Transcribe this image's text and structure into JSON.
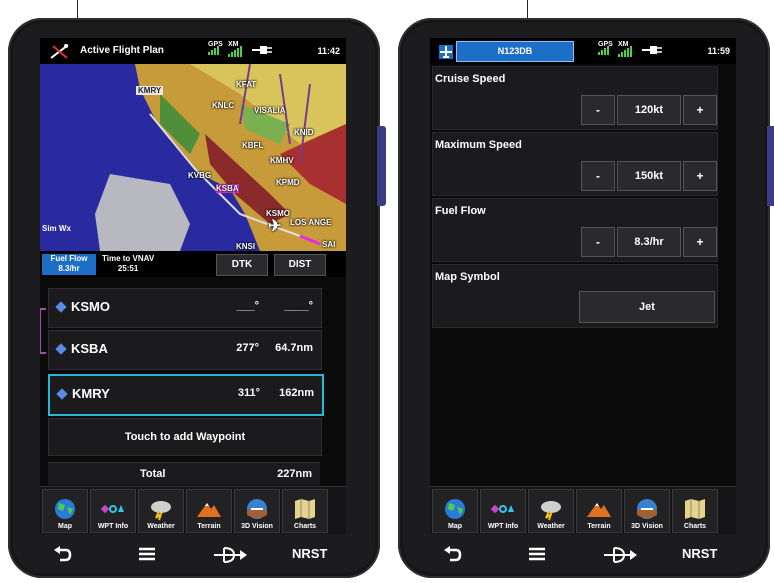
{
  "left_screen": {
    "title": "Active Flight Plan",
    "status": {
      "gps": "GPS",
      "xm": "XM",
      "time": "11:42"
    },
    "map": {
      "labels": [
        "KFAT",
        "KMRY",
        "KNLC",
        "VISALIA",
        "KNID",
        "KBFL",
        "KMHV",
        "KVBG",
        "KSBA",
        "KPMD",
        "KSMO",
        "LOS ANGE",
        "KNSI",
        "SAI"
      ],
      "sim_wx": "Sim Wx"
    },
    "info": {
      "fuel_flow_label": "Fuel Flow",
      "fuel_flow_value": "8.3/hr",
      "vnav_label": "Time to VNAV",
      "vnav_value": "25:51",
      "col1": "DTK",
      "col2": "DIST"
    },
    "waypoints": [
      {
        "name": "KSMO",
        "dtk": "___°",
        "dist": "____°"
      },
      {
        "name": "KSBA",
        "dtk": "277°",
        "dist": "64.7nm"
      },
      {
        "name": "KMRY",
        "dtk": "311°",
        "dist": "162nm"
      }
    ],
    "add_waypoint": "Touch to add Waypoint",
    "total_label": "Total",
    "total_value": "227nm"
  },
  "right_screen": {
    "tail_number": "N123DB",
    "status": {
      "gps": "GPS",
      "xm": "XM",
      "time": "11:59"
    },
    "cruise": {
      "title": "Cruise Speed",
      "minus": "-",
      "value": "120kt",
      "plus": "+"
    },
    "max": {
      "title": "Maximum Speed",
      "minus": "-",
      "value": "150kt",
      "plus": "+"
    },
    "fuel": {
      "title": "Fuel Flow",
      "minus": "-",
      "value": "8.3/hr",
      "plus": "+"
    },
    "symbol": {
      "title": "Map Symbol",
      "value": "Jet"
    }
  },
  "dock": [
    "Map",
    "WPT Info",
    "Weather",
    "Terrain",
    "3D Vision",
    "Charts"
  ],
  "hardware": {
    "back_icon": "back-arrow-icon",
    "menu_icon": "menu-icon",
    "direct_to_icon": "direct-to-icon",
    "nrst": "NRST"
  }
}
